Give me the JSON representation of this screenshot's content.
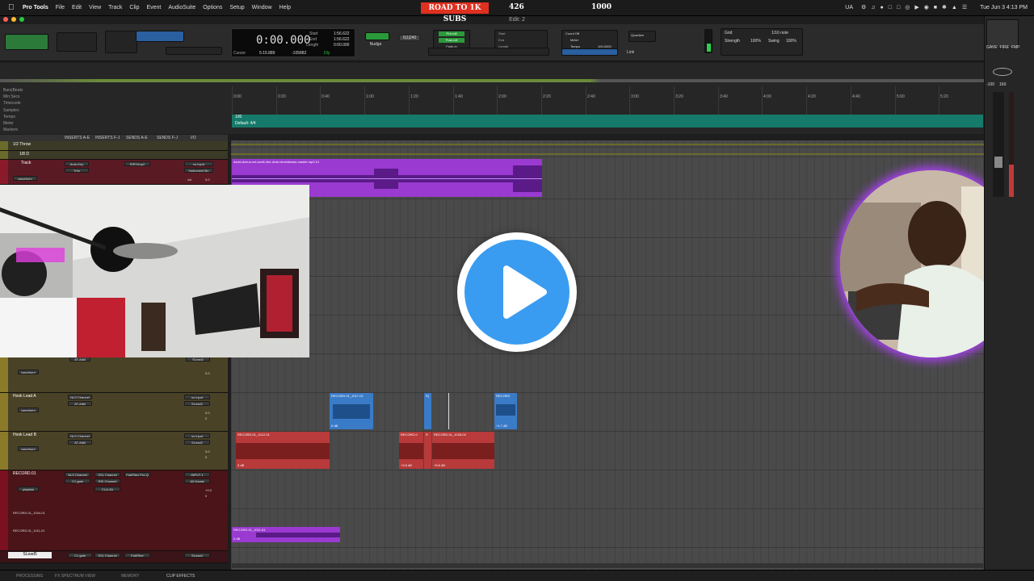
{
  "menubar": {
    "app": "Pro Tools",
    "items": [
      "File",
      "Edit",
      "View",
      "Track",
      "Clip",
      "Event",
      "AudioSuite",
      "Options",
      "Setup",
      "Window",
      "Help"
    ],
    "banner": "ROAD TO 1K SUBS",
    "count_a": "426",
    "count_b": "1000",
    "clock": "Tue Jun 3  4:13 PM",
    "status_icon": "UA"
  },
  "window_title": "Edit: 2",
  "counter": {
    "main": "0:00.000",
    "start_label": "Start",
    "end_label": "End",
    "length_label": "Length",
    "start": "1:56.622",
    "end": "1:56.622",
    "length": "0:00.000",
    "cursor_label": "Cursor",
    "cursor": "5:15.889",
    "nudge_value": "-105882",
    "dly_label": "Dly"
  },
  "toolbar": {
    "grid_value": "0|1|240",
    "nudge_label": "Nudge",
    "pre_roll": "Pre-roll",
    "post_roll": "Post-roll",
    "fade_in": "Fade-in",
    "start2": "Start",
    "end2": "End",
    "length2": "Length",
    "count_off": "Count Off",
    "meter": "Meter",
    "tempo": "Tempo",
    "tempo_value": "100.0000",
    "link_label": "Link",
    "quantize_label": "Quantize",
    "grid_label": "Grid",
    "grid_val": "1/16 note",
    "strength_label": "Strength",
    "strength": "100%",
    "swing_label": "Swing",
    "swing": "100%"
  },
  "rulers": [
    "Bars|Beats",
    "Min:Secs",
    "Timecode",
    "Samples",
    "Tempo",
    "Meter",
    "Markers"
  ],
  "ruler_ticks": [
    "0:00",
    "0:20",
    "0:40",
    "1:00",
    "1:20",
    "1:40",
    "2:00",
    "2:20",
    "2:40",
    "3:00",
    "3:20",
    "3:40",
    "4:00",
    "4:20",
    "4:40",
    "5:00",
    "5:20"
  ],
  "tempo_label": "Default: 4/4",
  "tempo_mark": "100",
  "mix_header": [
    "I/O",
    "INSERTS A-E",
    "INSERTS F-J",
    "SENDS A-E",
    "SENDS F-J"
  ],
  "tracks": [
    {
      "name": "1/2 Throw",
      "color": "#6a6a2a"
    },
    {
      "name": "1/8 D",
      "color": "#6a6a2a"
    },
    {
      "name": "Track",
      "color": "#8a1a2a",
      "insert": "Auto-Key",
      "insert2": "Trim",
      "send": "RIP1Dup2",
      "io": "no input",
      "io2": "Instrument Bu",
      "view": "waveform",
      "vol": "vol",
      "vol_val": "0.0"
    },
    {
      "name": "Hook Lead A",
      "color": "#8a7a2a",
      "insert": "NLS Channel",
      "send": "AT-Adkl",
      "io": "no input",
      "io2": "SLead2",
      "view": "waveform",
      "vol_val": "0.0",
      "pan_val": "0"
    },
    {
      "name": "Hook Lead B",
      "color": "#8a7a2a",
      "insert": "NLS Channel",
      "send": "AT-Adkl",
      "io": "no input",
      "io2": "SLead2",
      "view": "waveform",
      "vol_val": "0.0",
      "pan_val": "0"
    },
    {
      "name": "RECORD.01",
      "color": "#7a1020",
      "insert": "NLS Channel",
      "insert_b": "C1 gate",
      "insert_c": "SSL Channel",
      "insert_d": "RSI Channel",
      "send": "FabFilter Pro-Q",
      "send2": "CLA-3A",
      "io": "INPUT 1",
      "io2": "All Vocals",
      "view": "playlists",
      "vol_val": "+0.0",
      "pan_val": "0"
    },
    {
      "name": "SLead5",
      "color": "#6a1a2a",
      "insert": "C1 gate",
      "insert2": "SSL Channel",
      "send": "FabFilter",
      "io": "SLead4"
    }
  ],
  "clips": {
    "beat": "david-dzeus-not-worth-the-drain-devidiamas-master.mp3-01",
    "lead_a_1": "RECORD.01_1017-01",
    "lead_a_2": "R(",
    "lead_a_3": "RECORD",
    "lead_a_gain1": "0 dB",
    "lead_a_gain3": "+1.7 dB",
    "lead_b_1": "RECORD.01_1012-01",
    "lead_b_2": "RECORD.0",
    "lead_b_3": "R",
    "lead_b_4": "RECORD.01_1028-04",
    "lead_b_gain1": "0 dB",
    "lead_b_gain2": "+3.6 dB",
    "lead_b_gain4": "+6.6 dB",
    "rec_1": "RECORD.01_1011-01",
    "rec_gain": "0 dB",
    "playlist_1": "RECORD.01_1004-01",
    "playlist_2": "RECORD.01_1011-01"
  },
  "right_panel": {
    "tabs": [
      "GAVE",
      "FIRE",
      "FMP"
    ],
    "meter_vals": [
      "-100",
      "160"
    ]
  },
  "bottom_tabs": [
    "PROCESSING",
    "FX SPECTRUM VIEW",
    "MEMORY",
    "CLIP EFFECTS"
  ],
  "colors": {
    "purple_clip": "#9a3ad0",
    "blue_clip": "#3a7bc8",
    "red_clip": "#b83a3a",
    "teal": "#157a6a",
    "play_blue": "#3a9cf0"
  }
}
